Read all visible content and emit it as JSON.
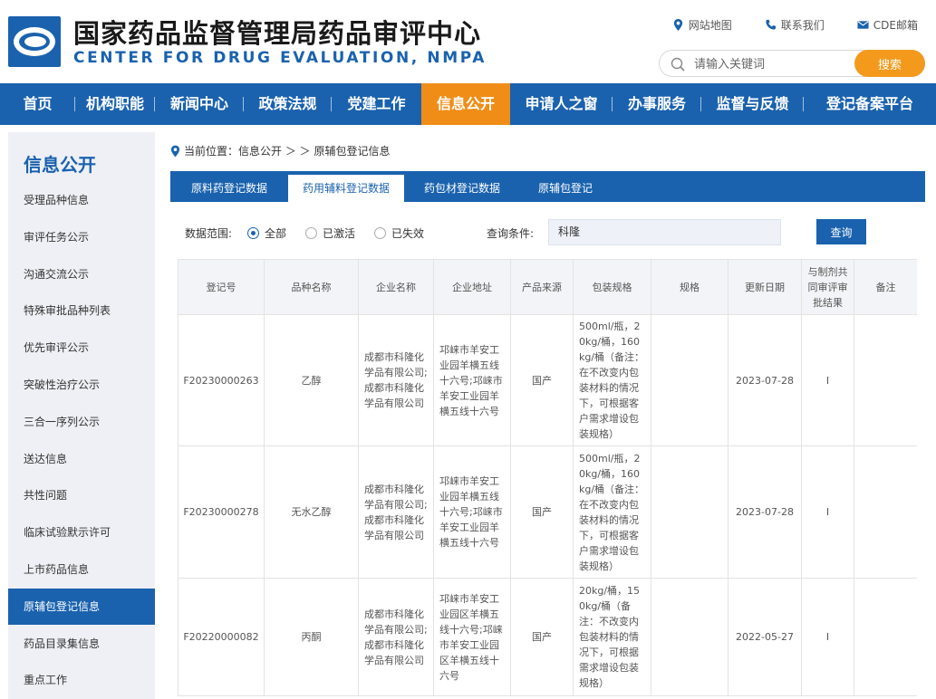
{
  "header": {
    "title": "国家药品监督管理局药品审评中心",
    "subtitle": "CENTER FOR DRUG EVALUATION, NMPA",
    "links": [
      "网站地图",
      "联系我们",
      "CDE邮箱"
    ],
    "search_placeholder": "请输入关键词",
    "search_button": "搜索"
  },
  "nav": {
    "items": [
      "首页",
      "机构职能",
      "新闻中心",
      "政策法规",
      "党建工作",
      "信息公开",
      "申请人之窗",
      "办事服务",
      "监督与反馈",
      "登记备案平台"
    ],
    "active": "信息公开"
  },
  "sidebar": {
    "title": "信息公开",
    "items": [
      "受理品种信息",
      "审评任务公示",
      "沟通交流公示",
      "特殊审批品种列表",
      "优先审评公示",
      "突破性治疗公示",
      "三合一序列公示",
      "送达信息",
      "共性问题",
      "临床试验默示许可",
      "上市药品信息",
      "原辅包登记信息",
      "药品目录集信息",
      "重点工作"
    ],
    "active": "原辅包登记信息"
  },
  "breadcrumb": {
    "text": "当前位置：信息公开 ＞ ＞ 原辅包登记信息"
  },
  "tabs": {
    "items": [
      "原料药登记数据",
      "药用辅料登记数据",
      "药包材登记数据",
      "原辅包登记"
    ],
    "active": "药用辅料登记数据"
  },
  "filter": {
    "scope_label": "数据范围:",
    "options": [
      "全部",
      "已激活",
      "已失效"
    ],
    "selected": "全部",
    "condition_label": "查询条件:",
    "condition_value": "科隆",
    "query_button": "查询"
  },
  "table": {
    "headers": [
      "登记号",
      "品种名称",
      "企业名称",
      "企业地址",
      "产品来源",
      "包装规格",
      "规格",
      "更新日期",
      "与制剂共同审评审批结果",
      "备注"
    ],
    "rows": [
      {
        "reg_no": "F20230000263",
        "name": "乙醇",
        "company": "成都市科隆化学品有限公司;成都市科隆化学品有限公司",
        "address": "邛崃市羊安工业园羊横五线十六号;邛崃市羊安工业园羊横五线十六号",
        "source": "国产",
        "package": "500ml/瓶，20kg/桶，160kg/桶（备注：在不改变内包装材料的情况下，可根据客户需求增设包装规格）",
        "spec": "",
        "date": "2023-07-28",
        "result": "I",
        "remark": ""
      },
      {
        "reg_no": "F20230000278",
        "name": "无水乙醇",
        "company": "成都市科隆化学品有限公司;成都市科隆化学品有限公司",
        "address": "邛崃市羊安工业园羊横五线十六号;邛崃市羊安工业园羊横五线十六号",
        "source": "国产",
        "package": "500ml/瓶，20kg/桶，160kg/桶（备注：在不改变内包装材料的情况下，可根据客户需求增设包装规格）",
        "spec": "",
        "date": "2023-07-28",
        "result": "I",
        "remark": ""
      },
      {
        "reg_no": "F20220000082",
        "name": "丙酮",
        "company": "成都市科隆化学品有限公司;成都市科隆化学品有限公司",
        "address": "邛崃市羊安工业园区羊横五线十六号;邛崃市羊安工业园区羊横五线十六号",
        "source": "国产",
        "package": "20kg/桶，150kg/桶（备注：不改变内包装材料的情况下，可根据需求增设包装规格）",
        "spec": "",
        "date": "2022-05-27",
        "result": "I",
        "remark": ""
      }
    ]
  },
  "colors": {
    "brand_blue": "#1a62ae",
    "accent_orange": "#f08d17",
    "search_orange": "#f39a1d",
    "sidebar_bg": "#eef0f5"
  }
}
